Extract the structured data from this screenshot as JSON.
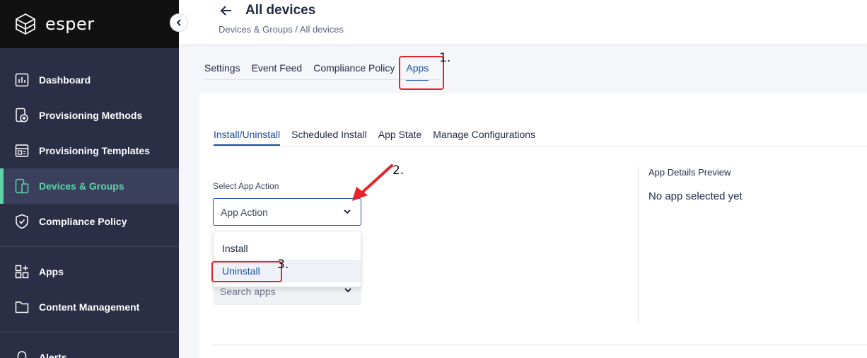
{
  "app": {
    "brand": "esper"
  },
  "sidebar": {
    "items": [
      {
        "label": "Dashboard",
        "icon": "dashboard-icon"
      },
      {
        "label": "Provisioning Methods",
        "icon": "provisioning-methods-icon"
      },
      {
        "label": "Provisioning Templates",
        "icon": "templates-icon"
      },
      {
        "label": "Devices & Groups",
        "icon": "devices-icon",
        "active": true
      },
      {
        "label": "Compliance Policy",
        "icon": "shield-icon"
      },
      {
        "label": "Apps",
        "icon": "apps-grid-icon"
      },
      {
        "label": "Content Management",
        "icon": "folder-icon"
      },
      {
        "label": "Alerts",
        "icon": "bell-icon"
      }
    ]
  },
  "header": {
    "title": "All devices",
    "breadcrumb": "Devices & Groups  / All devices"
  },
  "top_tabs": [
    "Settings",
    "Event Feed",
    "Compliance Policy",
    "Apps"
  ],
  "sub_tabs": [
    "Install/Uninstall",
    "Scheduled Install",
    "App State",
    "Manage Configurations"
  ],
  "form": {
    "select_label": "Select App Action",
    "select_value": "App Action",
    "options": [
      "Install",
      "Uninstall"
    ],
    "search_placeholder": "Search apps"
  },
  "preview": {
    "title": "App Details Preview",
    "empty_text": "No app selected yet"
  },
  "annotations": [
    "1.",
    "2.",
    "3."
  ],
  "colors": {
    "accent": "#1a4fa3",
    "active_nav": "#5dd3a8",
    "annotation": "#e8242b"
  }
}
